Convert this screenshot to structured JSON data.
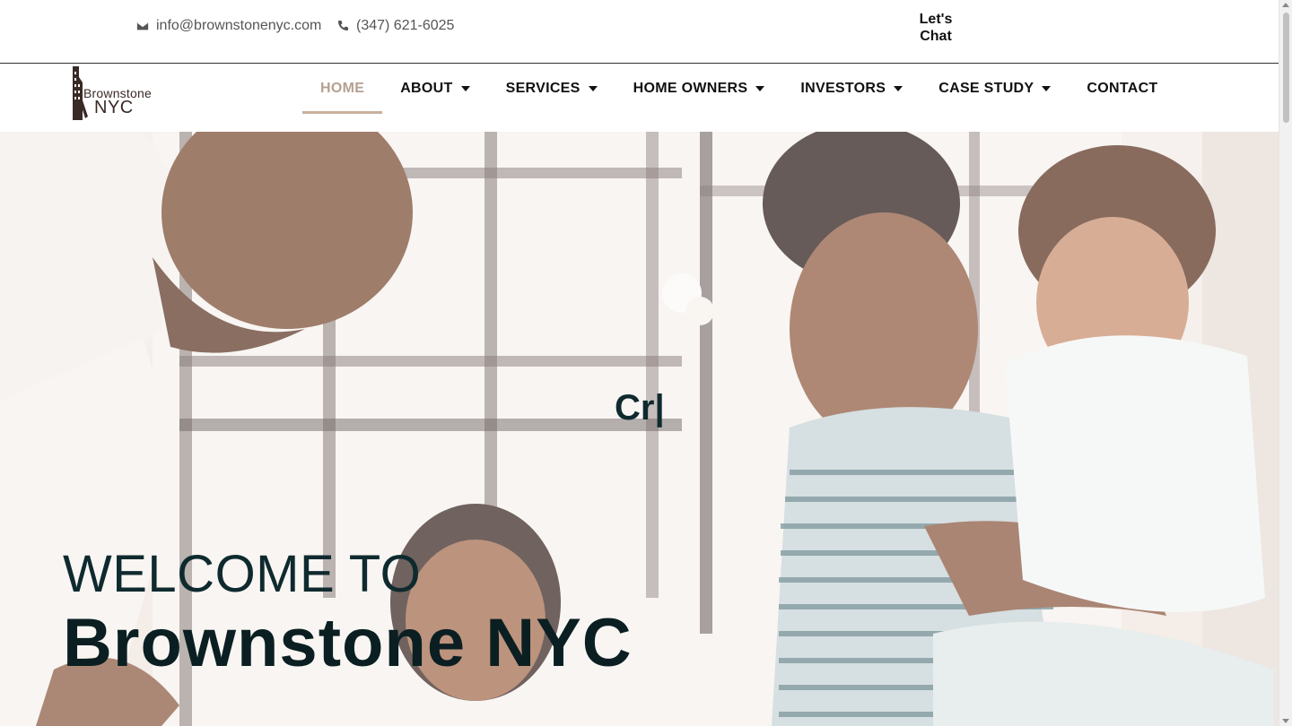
{
  "topbar": {
    "email": "info@brownstonenyc.com",
    "email_icon": "envelope-icon",
    "phone": "(347) 621-6025",
    "phone_icon": "phone-icon",
    "chat_label_line1": "Let's",
    "chat_label_line2": "Chat"
  },
  "logo": {
    "word1": "Brownstone",
    "word2": "NYC",
    "icon": "brownstone-building-icon"
  },
  "nav": {
    "items": [
      {
        "label": "HOME",
        "active": true,
        "has_dropdown": false
      },
      {
        "label": "ABOUT",
        "active": false,
        "has_dropdown": true
      },
      {
        "label": "SERVICES",
        "active": false,
        "has_dropdown": true
      },
      {
        "label": "HOME OWNERS",
        "active": false,
        "has_dropdown": true
      },
      {
        "label": "INVESTORS",
        "active": false,
        "has_dropdown": true
      },
      {
        "label": "CASE STUDY",
        "active": false,
        "has_dropdown": true
      },
      {
        "label": "CONTACT",
        "active": false,
        "has_dropdown": false
      }
    ]
  },
  "hero": {
    "typing_text": "Cr|",
    "welcome": "WELCOME TO",
    "title": "Brownstone NYC"
  },
  "colors": {
    "accent": "#c8b09c",
    "active_nav": "#b5a091",
    "heading": "#0b1f22",
    "logo_brown": "#3a2a26"
  }
}
